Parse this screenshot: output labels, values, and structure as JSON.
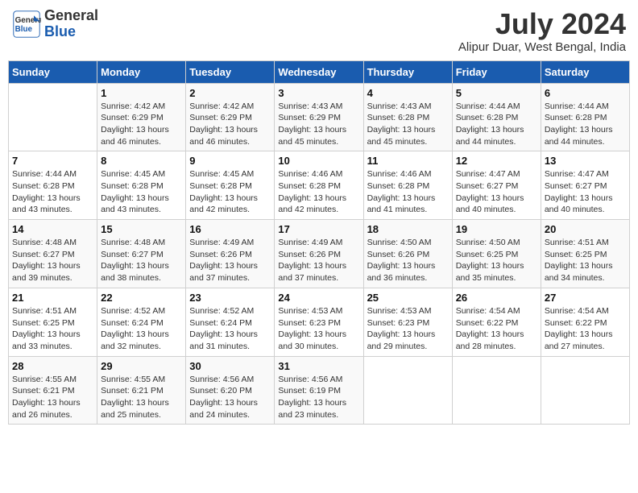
{
  "header": {
    "logo_line1": "General",
    "logo_line2": "Blue",
    "title": "July 2024",
    "subtitle": "Alipur Duar, West Bengal, India"
  },
  "calendar": {
    "days_of_week": [
      "Sunday",
      "Monday",
      "Tuesday",
      "Wednesday",
      "Thursday",
      "Friday",
      "Saturday"
    ],
    "weeks": [
      [
        {
          "day": "",
          "info": ""
        },
        {
          "day": "1",
          "info": "Sunrise: 4:42 AM\nSunset: 6:29 PM\nDaylight: 13 hours\nand 46 minutes."
        },
        {
          "day": "2",
          "info": "Sunrise: 4:42 AM\nSunset: 6:29 PM\nDaylight: 13 hours\nand 46 minutes."
        },
        {
          "day": "3",
          "info": "Sunrise: 4:43 AM\nSunset: 6:29 PM\nDaylight: 13 hours\nand 45 minutes."
        },
        {
          "day": "4",
          "info": "Sunrise: 4:43 AM\nSunset: 6:28 PM\nDaylight: 13 hours\nand 45 minutes."
        },
        {
          "day": "5",
          "info": "Sunrise: 4:44 AM\nSunset: 6:28 PM\nDaylight: 13 hours\nand 44 minutes."
        },
        {
          "day": "6",
          "info": "Sunrise: 4:44 AM\nSunset: 6:28 PM\nDaylight: 13 hours\nand 44 minutes."
        }
      ],
      [
        {
          "day": "7",
          "info": "Sunrise: 4:44 AM\nSunset: 6:28 PM\nDaylight: 13 hours\nand 43 minutes."
        },
        {
          "day": "8",
          "info": "Sunrise: 4:45 AM\nSunset: 6:28 PM\nDaylight: 13 hours\nand 43 minutes."
        },
        {
          "day": "9",
          "info": "Sunrise: 4:45 AM\nSunset: 6:28 PM\nDaylight: 13 hours\nand 42 minutes."
        },
        {
          "day": "10",
          "info": "Sunrise: 4:46 AM\nSunset: 6:28 PM\nDaylight: 13 hours\nand 42 minutes."
        },
        {
          "day": "11",
          "info": "Sunrise: 4:46 AM\nSunset: 6:28 PM\nDaylight: 13 hours\nand 41 minutes."
        },
        {
          "day": "12",
          "info": "Sunrise: 4:47 AM\nSunset: 6:27 PM\nDaylight: 13 hours\nand 40 minutes."
        },
        {
          "day": "13",
          "info": "Sunrise: 4:47 AM\nSunset: 6:27 PM\nDaylight: 13 hours\nand 40 minutes."
        }
      ],
      [
        {
          "day": "14",
          "info": "Sunrise: 4:48 AM\nSunset: 6:27 PM\nDaylight: 13 hours\nand 39 minutes."
        },
        {
          "day": "15",
          "info": "Sunrise: 4:48 AM\nSunset: 6:27 PM\nDaylight: 13 hours\nand 38 minutes."
        },
        {
          "day": "16",
          "info": "Sunrise: 4:49 AM\nSunset: 6:26 PM\nDaylight: 13 hours\nand 37 minutes."
        },
        {
          "day": "17",
          "info": "Sunrise: 4:49 AM\nSunset: 6:26 PM\nDaylight: 13 hours\nand 37 minutes."
        },
        {
          "day": "18",
          "info": "Sunrise: 4:50 AM\nSunset: 6:26 PM\nDaylight: 13 hours\nand 36 minutes."
        },
        {
          "day": "19",
          "info": "Sunrise: 4:50 AM\nSunset: 6:25 PM\nDaylight: 13 hours\nand 35 minutes."
        },
        {
          "day": "20",
          "info": "Sunrise: 4:51 AM\nSunset: 6:25 PM\nDaylight: 13 hours\nand 34 minutes."
        }
      ],
      [
        {
          "day": "21",
          "info": "Sunrise: 4:51 AM\nSunset: 6:25 PM\nDaylight: 13 hours\nand 33 minutes."
        },
        {
          "day": "22",
          "info": "Sunrise: 4:52 AM\nSunset: 6:24 PM\nDaylight: 13 hours\nand 32 minutes."
        },
        {
          "day": "23",
          "info": "Sunrise: 4:52 AM\nSunset: 6:24 PM\nDaylight: 13 hours\nand 31 minutes."
        },
        {
          "day": "24",
          "info": "Sunrise: 4:53 AM\nSunset: 6:23 PM\nDaylight: 13 hours\nand 30 minutes."
        },
        {
          "day": "25",
          "info": "Sunrise: 4:53 AM\nSunset: 6:23 PM\nDaylight: 13 hours\nand 29 minutes."
        },
        {
          "day": "26",
          "info": "Sunrise: 4:54 AM\nSunset: 6:22 PM\nDaylight: 13 hours\nand 28 minutes."
        },
        {
          "day": "27",
          "info": "Sunrise: 4:54 AM\nSunset: 6:22 PM\nDaylight: 13 hours\nand 27 minutes."
        }
      ],
      [
        {
          "day": "28",
          "info": "Sunrise: 4:55 AM\nSunset: 6:21 PM\nDaylight: 13 hours\nand 26 minutes."
        },
        {
          "day": "29",
          "info": "Sunrise: 4:55 AM\nSunset: 6:21 PM\nDaylight: 13 hours\nand 25 minutes."
        },
        {
          "day": "30",
          "info": "Sunrise: 4:56 AM\nSunset: 6:20 PM\nDaylight: 13 hours\nand 24 minutes."
        },
        {
          "day": "31",
          "info": "Sunrise: 4:56 AM\nSunset: 6:19 PM\nDaylight: 13 hours\nand 23 minutes."
        },
        {
          "day": "",
          "info": ""
        },
        {
          "day": "",
          "info": ""
        },
        {
          "day": "",
          "info": ""
        }
      ]
    ]
  }
}
